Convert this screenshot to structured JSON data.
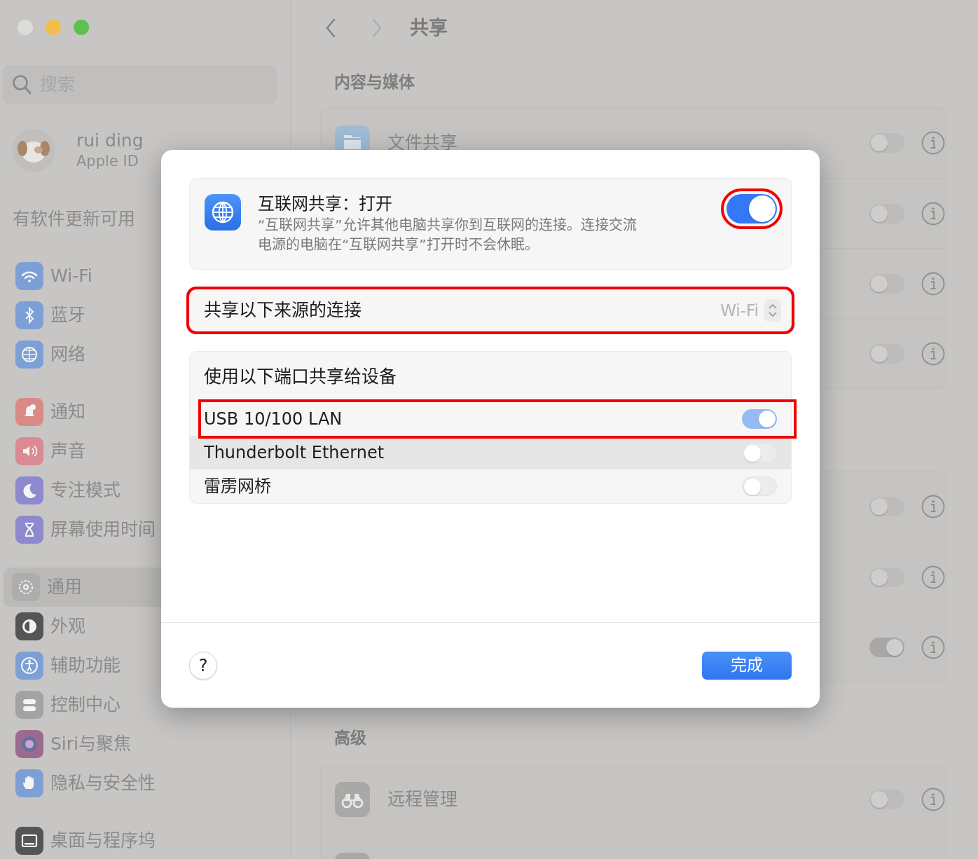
{
  "window": {
    "traffic_lights": [
      {
        "color": "#dddcdb"
      },
      {
        "color": "#f2bd4c"
      },
      {
        "color": "#5dc050"
      }
    ]
  },
  "sidebar": {
    "search": {
      "placeholder": "搜索"
    },
    "account": {
      "name": "rui ding",
      "subtitle": "Apple ID"
    },
    "notice": "有软件更新可用",
    "groups": [
      [
        {
          "label": "Wi-Fi",
          "color": "#7c9fd6",
          "selected": false
        },
        {
          "label": "蓝牙",
          "color": "#7c9fd6",
          "selected": false
        },
        {
          "label": "网络",
          "color": "#7c9fd6",
          "selected": false
        }
      ],
      [
        {
          "label": "通知",
          "color": "#d98a86",
          "selected": false
        },
        {
          "label": "声音",
          "color": "#d98a93",
          "selected": false
        },
        {
          "label": "专注模式",
          "color": "#8d89cc",
          "selected": false
        },
        {
          "label": "屏幕使用时间",
          "color": "#8d89cc",
          "selected": false
        }
      ],
      [
        {
          "label": "通用",
          "color": "#aeadac",
          "selected": true
        },
        {
          "label": "外观",
          "color": "#555555",
          "selected": false
        },
        {
          "label": "辅助功能",
          "color": "#7c9fd6",
          "selected": false
        },
        {
          "label": "控制中心",
          "color": "#a4a3a2",
          "selected": false
        },
        {
          "label": "Siri与聚焦",
          "color": "#9a6b8e",
          "selected": false
        },
        {
          "label": "隐私与安全性",
          "color": "#7c9fd6",
          "selected": false
        }
      ],
      [
        {
          "label": "桌面与程序坞",
          "color": "#555555",
          "selected": false
        }
      ]
    ]
  },
  "toolbar": {
    "nav": [
      {
        "kind": "back",
        "disabled": false
      },
      {
        "kind": "forward",
        "disabled": true
      }
    ],
    "title": "共享"
  },
  "sections": [
    {
      "title": "内容与媒体",
      "rows": [
        {
          "title": "文件共享",
          "color": "#9fbcd4",
          "on": false
        },
        {
          "on": false
        },
        {
          "on": false
        },
        {
          "on": false
        }
      ]
    },
    {
      "rows": [
        {
          "on": false
        },
        {
          "on": false
        },
        {
          "on": true
        }
      ]
    },
    {
      "title": "高级",
      "rows": [
        {
          "title": "远程管理",
          "color": "#a9a8a7",
          "on": false
        },
        {
          "color": "#a9a8a7"
        }
      ]
    }
  ],
  "dialog": {
    "feature": {
      "title": "互联网共享：打开",
      "description": "“互联网共享”允许其他电脑共享你到互联网的连接。连接交流电源的电脑在“互联网共享”打开时不会休眠。",
      "on": true,
      "highlighted": true
    },
    "source": {
      "label": "共享以下来源的连接",
      "value": "Wi-Fi",
      "highlighted": true
    },
    "ports": {
      "title": "使用以下端口共享给设备",
      "items": [
        {
          "label": "USB 10/100 LAN",
          "on": true,
          "disabled": true,
          "selected": false,
          "highlighted": true
        },
        {
          "label": "Thunderbolt Ethernet",
          "on": false,
          "disabled": true,
          "selected": true,
          "highlighted": false
        },
        {
          "label": "雷雳网桥",
          "on": false,
          "disabled": true,
          "selected": false,
          "highlighted": false
        }
      ]
    },
    "help": "?",
    "done": "完成"
  }
}
